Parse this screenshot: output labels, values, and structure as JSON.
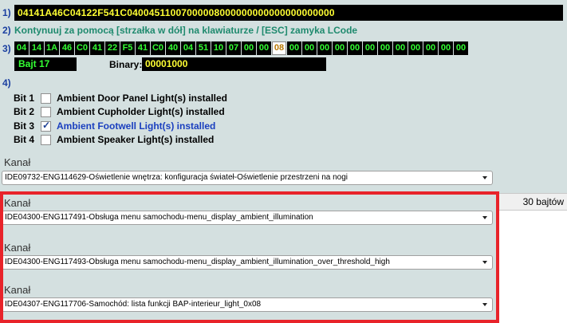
{
  "step1": {
    "number": "1)",
    "coding_string": "04141A46C04122F541C04004511007000008000000000000000000000"
  },
  "step2": {
    "number": "2)",
    "instruction": "Kontynuuj za pomocą [strzałka w dół] na klawiaturze / [ESC] zamyka LCode"
  },
  "step3": {
    "number": "3)",
    "bytes": [
      "04",
      "14",
      "1A",
      "46",
      "C0",
      "41",
      "22",
      "F5",
      "41",
      "C0",
      "40",
      "04",
      "51",
      "10",
      "07",
      "00",
      "00",
      "08",
      "00",
      "00",
      "00",
      "00",
      "00",
      "00",
      "00",
      "00",
      "00",
      "00",
      "00",
      "00"
    ],
    "selected_index": 17,
    "byte_label": "Bajt 17",
    "binary_label": "Binary:",
    "binary_value": "00001000"
  },
  "step4": {
    "number": "4)",
    "bits": [
      {
        "name": "Bit 1",
        "desc": "Ambient Door Panel Light(s) installed",
        "checked": false
      },
      {
        "name": "Bit 2",
        "desc": "Ambient Cupholder Light(s) installed",
        "checked": false
      },
      {
        "name": "Bit 3",
        "desc": "Ambient Footwell Light(s) installed",
        "checked": true
      },
      {
        "name": "Bit 4",
        "desc": "Ambient Speaker Light(s) installed",
        "checked": false
      }
    ]
  },
  "channels": [
    {
      "label": "Kanał",
      "value": "IDE09732-ENG114629-Oświetlenie wnętrza: konfiguracja świateł-Oświetlenie przestrzeni na nogi"
    },
    {
      "label": "Kanał",
      "value": "IDE04300-ENG117491-Obsługa menu samochodu-menu_display_ambient_illumination"
    },
    {
      "label": "Kanał",
      "value": "IDE04300-ENG117493-Obsługa menu samochodu-menu_display_ambient_illumination_over_threshold_high"
    },
    {
      "label": "Kanał",
      "value": "IDE04307-ENG117706-Samochód: lista funkcji BAP-interieur_light_0x08"
    }
  ],
  "status": {
    "bytes_count": "30 bajtów"
  },
  "colors": {
    "highlight": "#e8232a",
    "background": "#d4e0e0"
  }
}
